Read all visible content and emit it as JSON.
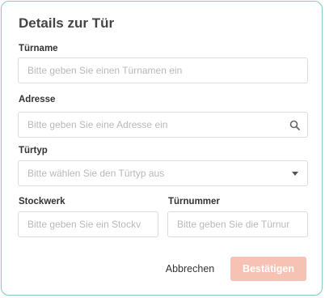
{
  "dialog": {
    "title": "Details zur Tür",
    "fields": {
      "door_name": {
        "label": "Türname",
        "placeholder": "Bitte geben Sie einen Türnamen ein",
        "value": ""
      },
      "address": {
        "label": "Adresse",
        "placeholder": "Bitte geben Sie eine Adresse ein",
        "value": "",
        "icon": "search-icon"
      },
      "door_type": {
        "label": "Türtyp",
        "placeholder": "Bitte wählen Sie den Türtyp aus",
        "value": "",
        "icon": "caret-down-icon"
      },
      "floor": {
        "label": "Stockwerk",
        "placeholder": "Bitte geben Sie ein Stockv",
        "value": ""
      },
      "door_number": {
        "label": "Türnummer",
        "placeholder": "Bitte geben Sie die Türnur",
        "value": ""
      }
    },
    "buttons": {
      "cancel_label": "Abbrechen",
      "confirm_label": "Bestätigen"
    },
    "colors": {
      "border": "#8ec5c8",
      "confirm_bg": "#f5c2b3"
    }
  }
}
